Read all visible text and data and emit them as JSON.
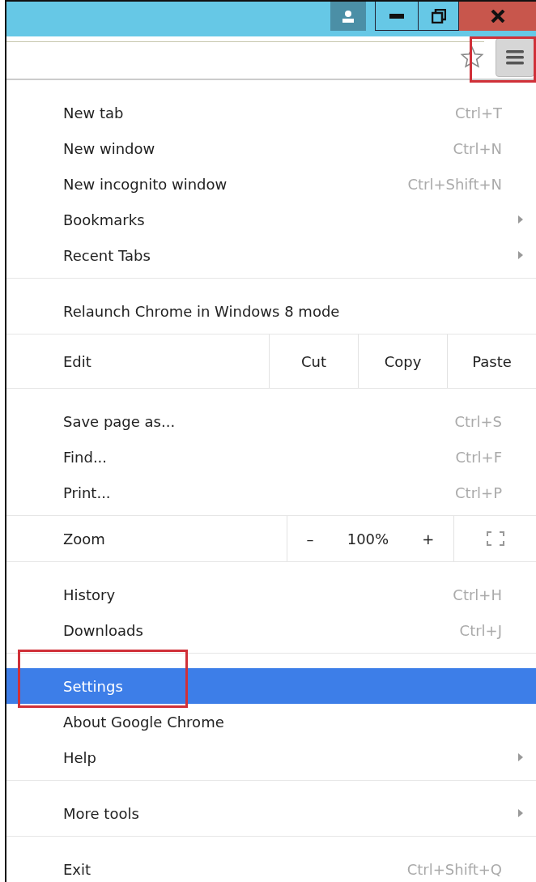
{
  "menu": {
    "groups": [
      {
        "items": [
          {
            "kind": "item",
            "label": "New tab",
            "shortcut": "Ctrl+T",
            "submenu": false,
            "selected": false
          },
          {
            "kind": "item",
            "label": "New window",
            "shortcut": "Ctrl+N",
            "submenu": false,
            "selected": false
          },
          {
            "kind": "item",
            "label": "New incognito window",
            "shortcut": "Ctrl+Shift+N",
            "submenu": false,
            "selected": false
          },
          {
            "kind": "item",
            "label": "Bookmarks",
            "submenu": true,
            "selected": false
          },
          {
            "kind": "item",
            "label": "Recent Tabs",
            "submenu": true,
            "selected": false
          }
        ]
      },
      {
        "items": [
          {
            "kind": "item",
            "label": "Relaunch Chrome in Windows 8 mode",
            "submenu": false,
            "selected": false
          }
        ]
      },
      {
        "items": [
          {
            "kind": "edit",
            "label": "Edit",
            "buttons": [
              "Cut",
              "Copy",
              "Paste"
            ]
          }
        ]
      },
      {
        "items": [
          {
            "kind": "item",
            "label": "Save page as...",
            "shortcut": "Ctrl+S",
            "submenu": false,
            "selected": false
          },
          {
            "kind": "item",
            "label": "Find...",
            "shortcut": "Ctrl+F",
            "submenu": false,
            "selected": false
          },
          {
            "kind": "item",
            "label": "Print...",
            "shortcut": "Ctrl+P",
            "submenu": false,
            "selected": false
          }
        ]
      },
      {
        "items": [
          {
            "kind": "zoom",
            "label": "Zoom",
            "minus": "–",
            "value": "100%",
            "plus": "+"
          }
        ]
      },
      {
        "items": [
          {
            "kind": "item",
            "label": "History",
            "shortcut": "Ctrl+H",
            "submenu": false,
            "selected": false
          },
          {
            "kind": "item",
            "label": "Downloads",
            "shortcut": "Ctrl+J",
            "submenu": false,
            "selected": false
          }
        ]
      },
      {
        "items": [
          {
            "kind": "item",
            "label": "Settings",
            "submenu": false,
            "selected": true
          },
          {
            "kind": "item",
            "label": "About Google Chrome",
            "submenu": false,
            "selected": false
          },
          {
            "kind": "item",
            "label": "Help",
            "submenu": true,
            "selected": false
          }
        ]
      },
      {
        "items": [
          {
            "kind": "item",
            "label": "More tools",
            "submenu": true,
            "selected": false
          }
        ]
      },
      {
        "items": [
          {
            "kind": "item",
            "label": "Exit",
            "shortcut": "Ctrl+Shift+Q",
            "submenu": false,
            "selected": false
          }
        ]
      }
    ]
  }
}
